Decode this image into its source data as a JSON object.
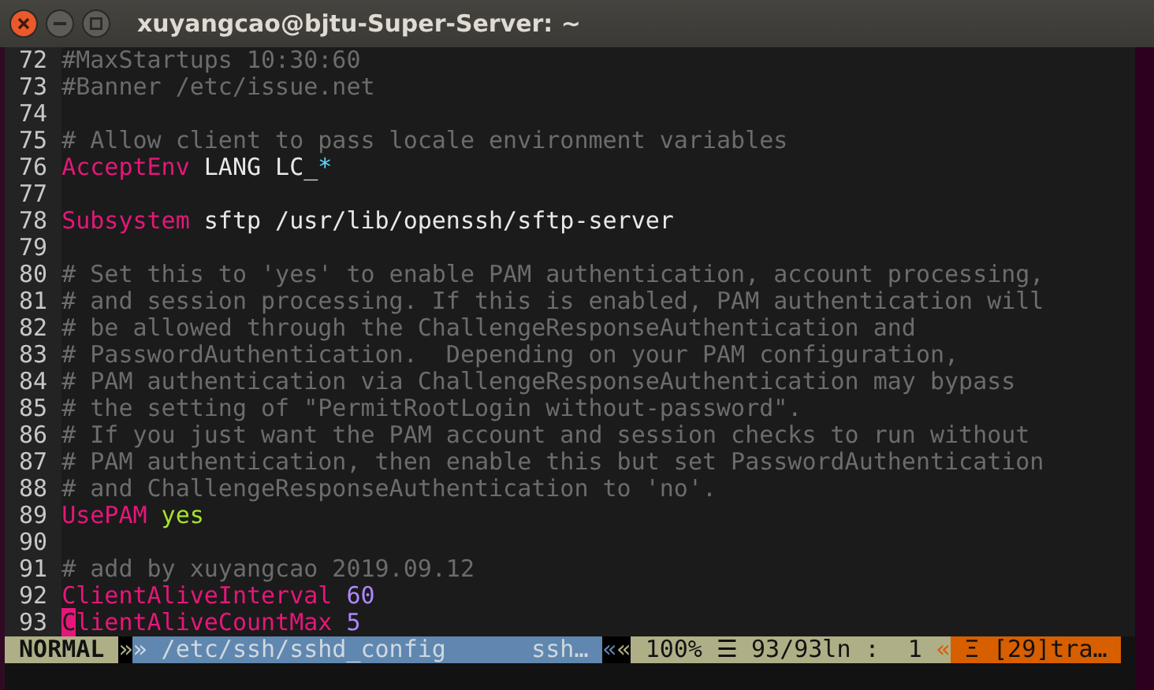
{
  "window": {
    "title": "xuyangcao@bjtu-Super-Server: ~"
  },
  "editor": {
    "lines": [
      {
        "number": "72",
        "segments": [
          {
            "kind": "comment",
            "text": "#MaxStartups 10:30:60"
          }
        ]
      },
      {
        "number": "73",
        "segments": [
          {
            "kind": "comment",
            "text": "#Banner /etc/issue.net"
          }
        ]
      },
      {
        "number": "74"
      },
      {
        "number": "75",
        "segments": [
          {
            "kind": "comment",
            "text": "# Allow client to pass locale environment variables"
          }
        ]
      },
      {
        "number": "76",
        "segments": [
          {
            "kind": "keyword",
            "text": "AcceptEnv"
          },
          {
            "kind": "text",
            "text": " LANG LC_"
          },
          {
            "kind": "special",
            "text": "*"
          }
        ]
      },
      {
        "number": "77"
      },
      {
        "number": "78",
        "segments": [
          {
            "kind": "keyword",
            "text": "Subsystem"
          },
          {
            "kind": "text",
            "text": " sftp /usr/lib/openssh/sftp-server"
          }
        ]
      },
      {
        "number": "79"
      },
      {
        "number": "80",
        "segments": [
          {
            "kind": "comment",
            "text": "# Set this to 'yes' to enable PAM authentication, account processing,"
          }
        ]
      },
      {
        "number": "81",
        "segments": [
          {
            "kind": "comment",
            "text": "# and session processing. If this is enabled, PAM authentication will"
          }
        ]
      },
      {
        "number": "82",
        "segments": [
          {
            "kind": "comment",
            "text": "# be allowed through the ChallengeResponseAuthentication and"
          }
        ]
      },
      {
        "number": "83",
        "segments": [
          {
            "kind": "comment",
            "text": "# PasswordAuthentication.  Depending on your PAM configuration,"
          }
        ]
      },
      {
        "number": "84",
        "segments": [
          {
            "kind": "comment",
            "text": "# PAM authentication via ChallengeResponseAuthentication may bypass"
          }
        ]
      },
      {
        "number": "85",
        "segments": [
          {
            "kind": "comment",
            "text": "# the setting of \"PermitRootLogin without-password\"."
          }
        ]
      },
      {
        "number": "86",
        "segments": [
          {
            "kind": "comment",
            "text": "# If you just want the PAM account and session checks to run without"
          }
        ]
      },
      {
        "number": "87",
        "segments": [
          {
            "kind": "comment",
            "text": "# PAM authentication, then enable this but set PasswordAuthentication"
          }
        ]
      },
      {
        "number": "88",
        "segments": [
          {
            "kind": "comment",
            "text": "# and ChallengeResponseAuthentication to 'no'."
          }
        ]
      },
      {
        "number": "89",
        "segments": [
          {
            "kind": "keyword",
            "text": "UsePAM"
          },
          {
            "kind": "boolean",
            "text": " yes"
          }
        ]
      },
      {
        "number": "90"
      },
      {
        "number": "91",
        "segments": [
          {
            "kind": "comment",
            "text": "# add by xuyangcao 2019.09.12"
          }
        ]
      },
      {
        "number": "92",
        "segments": [
          {
            "kind": "keyword",
            "text": "ClientAliveInterval"
          },
          {
            "kind": "number",
            "text": " 60"
          }
        ]
      },
      {
        "number": "93",
        "segments": [
          {
            "kind": "cursor",
            "text": "C"
          },
          {
            "kind": "keyword",
            "text": "lientAliveCountMax"
          },
          {
            "kind": "number",
            "text": " 5"
          }
        ]
      }
    ]
  },
  "status_bar": {
    "segments": [
      {
        "kind": "mode",
        "text": "NORMAL"
      },
      {
        "kind": "sep-dark",
        "text": "»"
      },
      {
        "kind": "file",
        "text": "» /etc/ssh/sshd_config"
      },
      {
        "kind": "filetype",
        "text": "ssh…"
      },
      {
        "kind": "sep-blue",
        "text": "«"
      },
      {
        "kind": "sep-dark",
        "text": "«"
      },
      {
        "kind": "position",
        "text": "100% ☰ 93/93ln :  1"
      },
      {
        "kind": "sep-orange",
        "text": "«"
      },
      {
        "kind": "warning",
        "text": "Ξ [29]tra…"
      }
    ]
  }
}
